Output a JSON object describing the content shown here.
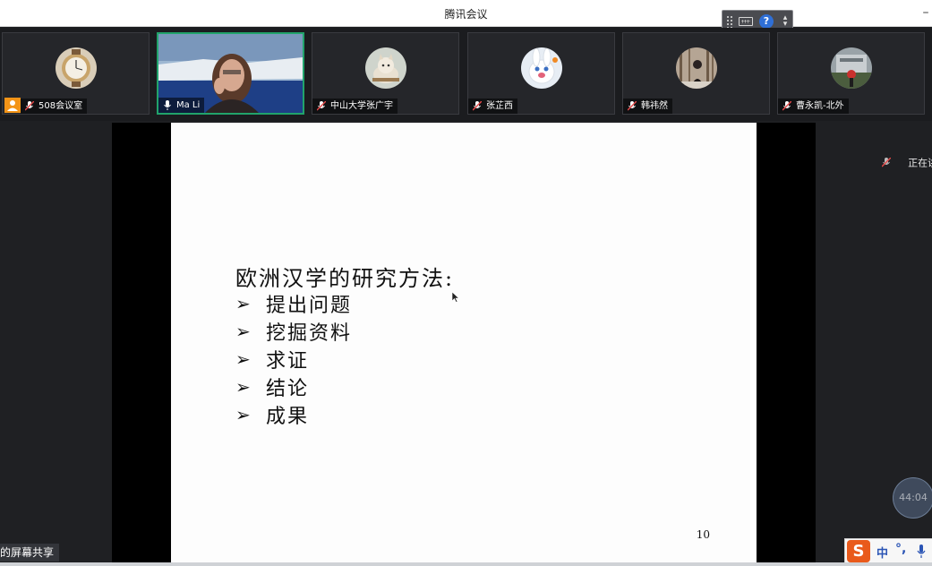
{
  "window": {
    "title": "腾讯会议",
    "minimize_glyph": "–"
  },
  "toolbar_icons": [
    "grip-icon",
    "keyboard-icon",
    "help-icon",
    "menu-icon"
  ],
  "help_glyph": "?",
  "participants": [
    {
      "name": "508会议室",
      "muted": true,
      "host": true,
      "avatar": "watch"
    },
    {
      "name": "Ma Li",
      "muted": false,
      "speaking": true,
      "avatar": "video"
    },
    {
      "name": "中山大学张广宇",
      "muted": true,
      "avatar": "cat"
    },
    {
      "name": "张芷西",
      "muted": true,
      "avatar": "bunny"
    },
    {
      "name": "韩祎然",
      "muted": true,
      "avatar": "person"
    },
    {
      "name": "曹永凯-北外",
      "muted": true,
      "avatar": "building"
    }
  ],
  "slide": {
    "title": "欧洲汉学的研究方法:",
    "bullets": [
      "提出问题",
      "挖掘资料",
      "求证",
      "结论",
      "成果"
    ],
    "page_number": "10",
    "bullet_glyph": "➢"
  },
  "right_panel": {
    "status_text": "正在讲"
  },
  "timer": "44:04",
  "share_label": "的屏幕共享",
  "ime": {
    "logo": "S",
    "lang": "中",
    "punct": "°,"
  },
  "colors": {
    "speaking_border": "#21a36b",
    "host_badge": "#f39417",
    "ime_logo": "#e95a1b"
  }
}
